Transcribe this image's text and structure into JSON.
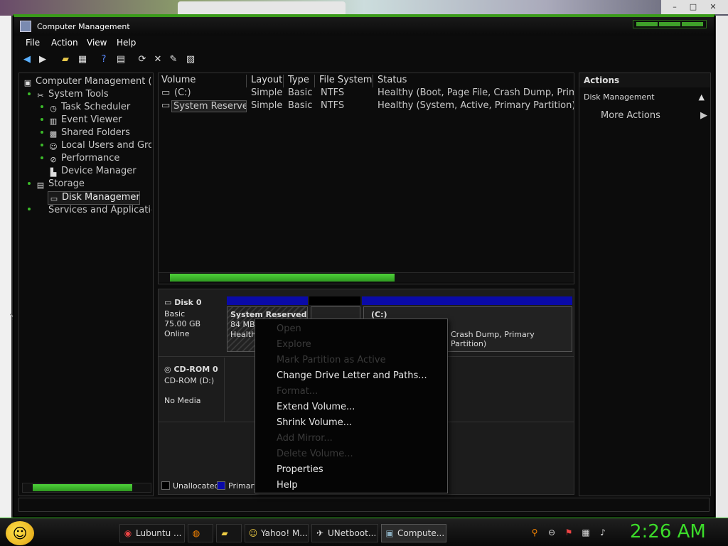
{
  "window": {
    "title": "Computer Management"
  },
  "menu": [
    "File",
    "Action",
    "View",
    "Help"
  ],
  "toolbar_icons": [
    "back-icon",
    "forward-icon",
    "up-folder-icon",
    "show-hide-icon",
    "help-icon",
    "properties-icon",
    "refresh-icon",
    "delete-icon",
    "export-icon",
    "check-icon"
  ],
  "tree": [
    {
      "label": "Computer Management (Loc",
      "icon": "computer-icon"
    },
    {
      "label": "System Tools",
      "icon": "tools-icon"
    },
    {
      "label": "Task Scheduler",
      "icon": "clock-icon"
    },
    {
      "label": "Event Viewer",
      "icon": "event-icon"
    },
    {
      "label": "Shared Folders",
      "icon": "shared-folder-icon"
    },
    {
      "label": "Local Users and Grou",
      "icon": "users-icon"
    },
    {
      "label": "Performance",
      "icon": "performance-icon"
    },
    {
      "label": "Device Manager",
      "icon": "device-icon"
    },
    {
      "label": "Storage",
      "icon": "storage-icon"
    },
    {
      "label": "Disk Management",
      "icon": "disk-icon"
    },
    {
      "label": "Services and Applications",
      "icon": "services-icon"
    }
  ],
  "volumes": {
    "headers": [
      "Volume",
      "Layout",
      "Type",
      "File System",
      "Status"
    ],
    "rows": [
      [
        "(C:)",
        "Simple",
        "Basic",
        "NTFS",
        "Healthy (Boot, Page File, Crash Dump, Primary"
      ],
      [
        "System Reserved",
        "Simple",
        "Basic",
        "NTFS",
        "Healthy (System, Active, Primary Partition)"
      ]
    ]
  },
  "disks": {
    "disk0": {
      "name": "Disk 0",
      "type": "Basic",
      "size": "75.00 GB",
      "state": "Online"
    },
    "cdrom0": {
      "name": "CD-ROM 0",
      "drive": "CD-ROM (D:)",
      "state": "No Media"
    },
    "partitions": {
      "reserved_name": "System Reserved",
      "reserved_info": "84 MB",
      "reserved_status": "Healthy",
      "c_name": "(C:)",
      "c_status": "Crash Dump, Primary Partition)"
    },
    "legend": [
      "Unallocated",
      "Primary"
    ]
  },
  "actions": {
    "header": "Actions",
    "section": "Disk Management",
    "more": "More Actions"
  },
  "context_menu": [
    {
      "label": "Open",
      "enabled": false
    },
    {
      "label": "Explore",
      "enabled": false
    },
    {
      "label": "Mark Partition as Active",
      "enabled": false
    },
    {
      "label": "Change Drive Letter and Paths...",
      "enabled": true
    },
    {
      "label": "Format...",
      "enabled": false
    },
    {
      "label": "Extend Volume...",
      "enabled": true
    },
    {
      "label": "Shrink Volume...",
      "enabled": true
    },
    {
      "label": "Add Mirror...",
      "enabled": false
    },
    {
      "label": "Delete Volume...",
      "enabled": false
    },
    {
      "label": "Properties",
      "enabled": true
    },
    {
      "label": "Help",
      "enabled": true
    }
  ],
  "taskbar": {
    "tasks": [
      "Lubuntu ...",
      "",
      "",
      "Yahoo! M...",
      "UNetboot...",
      "Compute..."
    ],
    "clock": "2:26 AM"
  },
  "colors": {
    "accent": "#3cbb2a",
    "primary_partition": "#0a0aa8"
  }
}
